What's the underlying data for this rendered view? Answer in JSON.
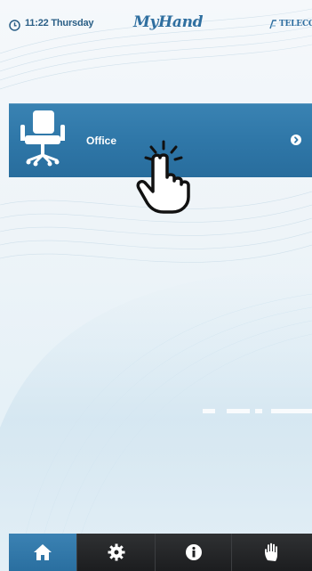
{
  "status_bar": {
    "time_text": "11:22 Thursday",
    "clock_icon": "clock-icon"
  },
  "brand": {
    "logo_text": "MyHand",
    "partner_text": "TELECO"
  },
  "menu": {
    "items": [
      {
        "label": "Office",
        "icon": "office-chair-icon",
        "arrow_icon": "chevron-right-icon"
      }
    ]
  },
  "tabs": [
    {
      "name": "home",
      "icon": "home-icon",
      "active": true
    },
    {
      "name": "settings",
      "icon": "gear-icon",
      "active": false
    },
    {
      "name": "info",
      "icon": "info-icon",
      "active": false
    },
    {
      "name": "hand",
      "icon": "hand-icon",
      "active": false
    }
  ],
  "colors": {
    "accent_blue": "#2f77a8",
    "tab_dark": "#1f2022",
    "text_blue": "#2a5f86",
    "background": "#eef4f8"
  }
}
